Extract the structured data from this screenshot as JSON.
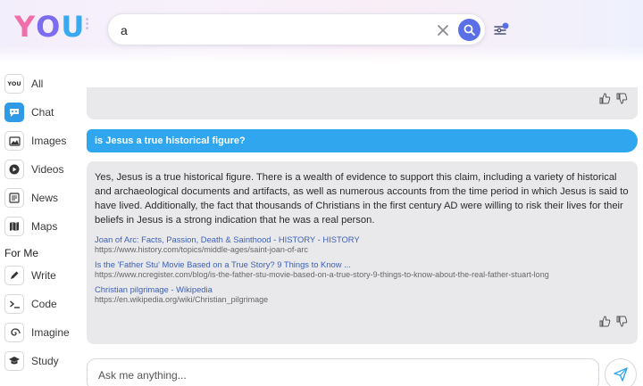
{
  "logo": {
    "text_y": "Y",
    "text_o": "O",
    "text_u": "U"
  },
  "search": {
    "value": "a"
  },
  "sidebar": {
    "items": [
      {
        "label": "All",
        "icon": "you-icon"
      },
      {
        "label": "Chat",
        "icon": "chat-icon"
      },
      {
        "label": "Images",
        "icon": "image-icon"
      },
      {
        "label": "Videos",
        "icon": "video-icon"
      },
      {
        "label": "News",
        "icon": "news-icon"
      },
      {
        "label": "Maps",
        "icon": "map-icon"
      }
    ],
    "for_me_label": "For Me",
    "for_me_items": [
      {
        "label": "Write",
        "icon": "pencil-icon"
      },
      {
        "label": "Code",
        "icon": "terminal-icon"
      },
      {
        "label": "Imagine",
        "icon": "spiral-icon"
      },
      {
        "label": "Study",
        "icon": "graduation-cap-icon"
      }
    ],
    "you_badge": "YOU"
  },
  "chat": {
    "question": "is Jesus a true historical figure?",
    "answer": "Yes, Jesus is a true historical figure. There is a wealth of evidence to support this claim, including a variety of historical and archaeological documents and artifacts, as well as numerous accounts from the time period in which Jesus is said to have lived. Additionally, the fact that thousands of Christians in the first century AD were willing to risk their lives for their beliefs in Jesus is a strong indication that he was a real person.",
    "sources": [
      {
        "title": "Joan of Arc: Facts, Passion, Death & Sainthood - HISTORY - HISTORY",
        "url": "https://www.history.com/topics/middle-ages/saint-joan-of-arc"
      },
      {
        "title": "Is the 'Father Stu' Movie Based on a True Story? 9 Things to Know ...",
        "url": "https://www.ncregister.com/blog/is-the-father-stu-movie-based-on-a-true-story-9-things-to-know-about-the-real-father-stuart-long"
      },
      {
        "title": "Christian pilgrimage - Wikipedia",
        "url": "https://en.wikipedia.org/wiki/Christian_pilgrimage"
      }
    ]
  },
  "composer": {
    "placeholder": "Ask me anything..."
  },
  "colors": {
    "accent": "#2fa6ee",
    "search_button": "#5a6fe6",
    "link": "#3c5fb4",
    "bubble": "#e9e9ec"
  }
}
